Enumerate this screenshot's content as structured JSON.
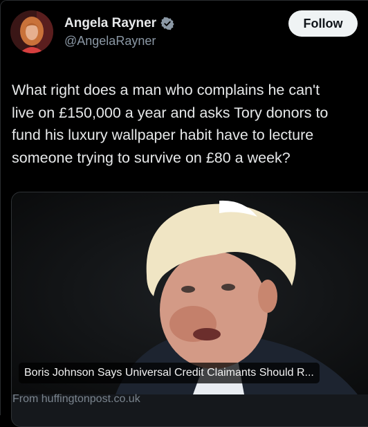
{
  "author": {
    "display_name": "Angela Rayner",
    "handle": "@AngelaRayner",
    "verified_icon": "verified-badge-icon",
    "verified_color": "#8b98a5"
  },
  "actions": {
    "follow_label": "Follow"
  },
  "tweet": {
    "lines": [
      "What right does a man who complains he can't",
      "live on £150,000 a year and asks Tory donors to",
      "fund his luxury wallpaper habit have to lecture",
      "someone trying to survive on £80 a week?"
    ]
  },
  "link_card": {
    "headline": "Boris Johnson Says Universal Credit Claimants Should R...",
    "source": "From huffingtonpost.co.uk"
  },
  "colors": {
    "background": "#000000",
    "text_primary": "#e7e9ea",
    "text_secondary": "#8b98a5",
    "follow_button_bg": "#eff3f4"
  }
}
